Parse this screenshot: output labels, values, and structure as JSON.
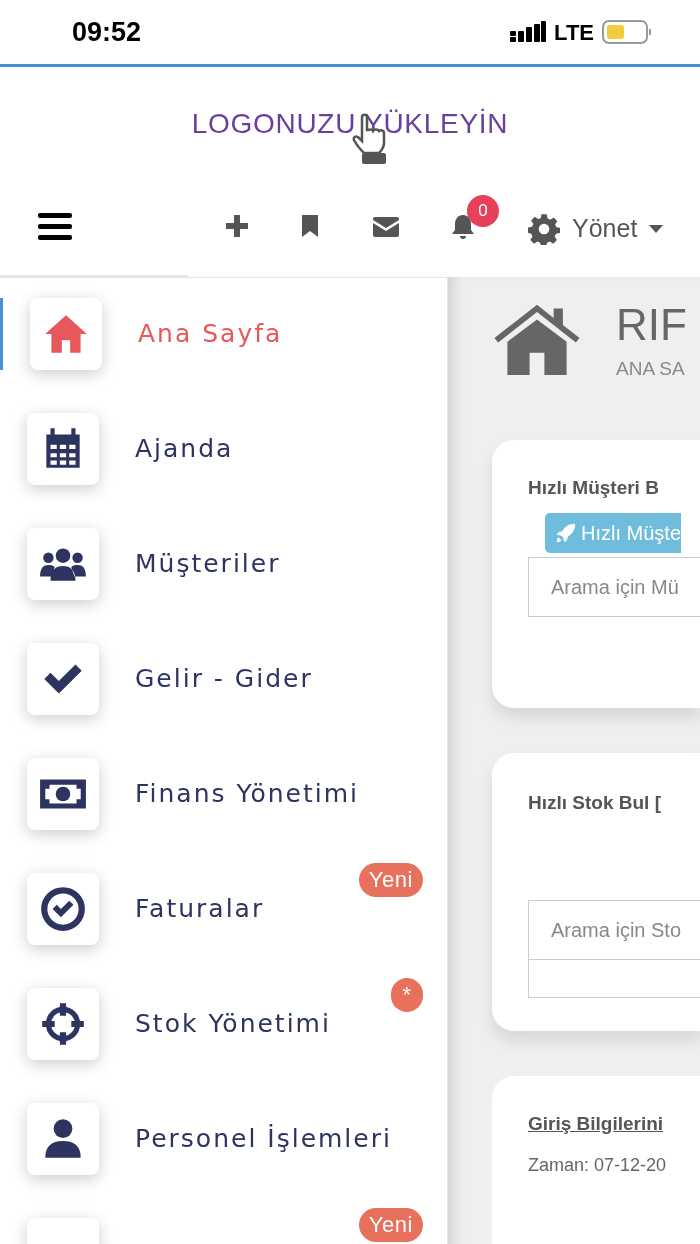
{
  "status_bar": {
    "time": "09:52",
    "network": "LTE"
  },
  "header": {
    "logo": "LOGONUZU YÜKLEYİN"
  },
  "toolbar": {
    "notification_count": "0",
    "manage_menu": "Yönet"
  },
  "sidebar": {
    "items": [
      {
        "kind": "home",
        "label": "Ana Sayfa",
        "selected": true
      },
      {
        "kind": "calendar",
        "label": "Ajanda",
        "selected": false
      },
      {
        "kind": "users",
        "label": "Müşteriler",
        "selected": false
      },
      {
        "kind": "check",
        "label": "Gelir - Gider",
        "selected": false
      },
      {
        "kind": "money",
        "label": "Finans Yönetimi",
        "selected": false
      },
      {
        "kind": "check-circle",
        "label": "Faturalar",
        "selected": false,
        "badge": "Yeni"
      },
      {
        "kind": "crosshairs",
        "label": "Stok Yönetimi",
        "selected": false,
        "badge": "*"
      },
      {
        "kind": "user",
        "label": "Personel İşlemleri",
        "selected": false
      },
      {
        "kind": "blank",
        "selected": false,
        "badge": "Yeni"
      }
    ]
  },
  "page_header": {
    "title": "RIF",
    "breadcrumb": "ANA SA"
  },
  "cards": [
    {
      "title": "Hızlı Müşteri B",
      "button": "Hızlı Müşte",
      "search": {
        "placeholder": "Arama için Mü"
      }
    },
    {
      "title": "Hızlı Stok Bul [",
      "search": {
        "placeholder": "Arama için Sto"
      }
    },
    {
      "title": "Giriş Bilgilerini",
      "text": "Zaman: 07-12-20"
    }
  ]
}
